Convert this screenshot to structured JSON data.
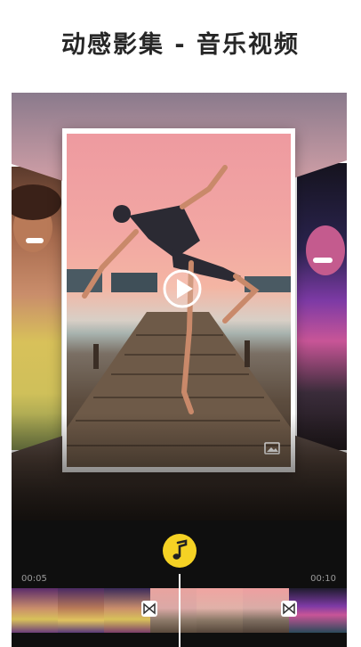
{
  "header": {
    "title": "动感影集 - 音乐视频"
  },
  "preview": {
    "play_icon": "play-icon",
    "gallery_icon": "gallery-icon",
    "style": "photo-carousel"
  },
  "timeline": {
    "start_time": "00:05",
    "end_time": "00:10",
    "music_icon": "music-note-icon",
    "transition_icon": "bowtie-transition-icon",
    "accent_color": "#f5d224"
  }
}
